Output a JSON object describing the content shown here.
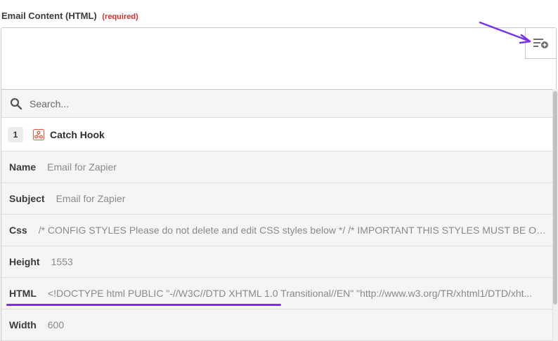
{
  "field": {
    "label": "Email Content (HTML)",
    "required_tag": "(required)"
  },
  "dropdown": {
    "search_placeholder": "Search...",
    "step": {
      "number": "1",
      "title": "Catch Hook",
      "icon": "webhook-icon"
    },
    "fields": [
      {
        "key": "Name",
        "value": "Email for Zapier"
      },
      {
        "key": "Subject",
        "value": "Email for Zapier"
      },
      {
        "key": "Css",
        "value": "/* CONFIG STYLES Please do not delete and edit CSS styles below */ /* IMPORTANT THIS STYLES MUST BE ON F..."
      },
      {
        "key": "Height",
        "value": "1553"
      },
      {
        "key": "HTML",
        "value": "<!DOCTYPE html PUBLIC \"-//W3C//DTD XHTML 1.0 Transitional//EN\" \"http://www.w3.org/TR/xhtml1/DTD/xht..."
      },
      {
        "key": "Width",
        "value": "600"
      }
    ]
  },
  "icons": {
    "insert_data": "insert-data-icon",
    "search": "search-icon"
  },
  "colors": {
    "required": "#d0312d",
    "annotation": "#7b2ff2",
    "row_bg": "#f5f5f5",
    "border": "#c8c8c8"
  }
}
